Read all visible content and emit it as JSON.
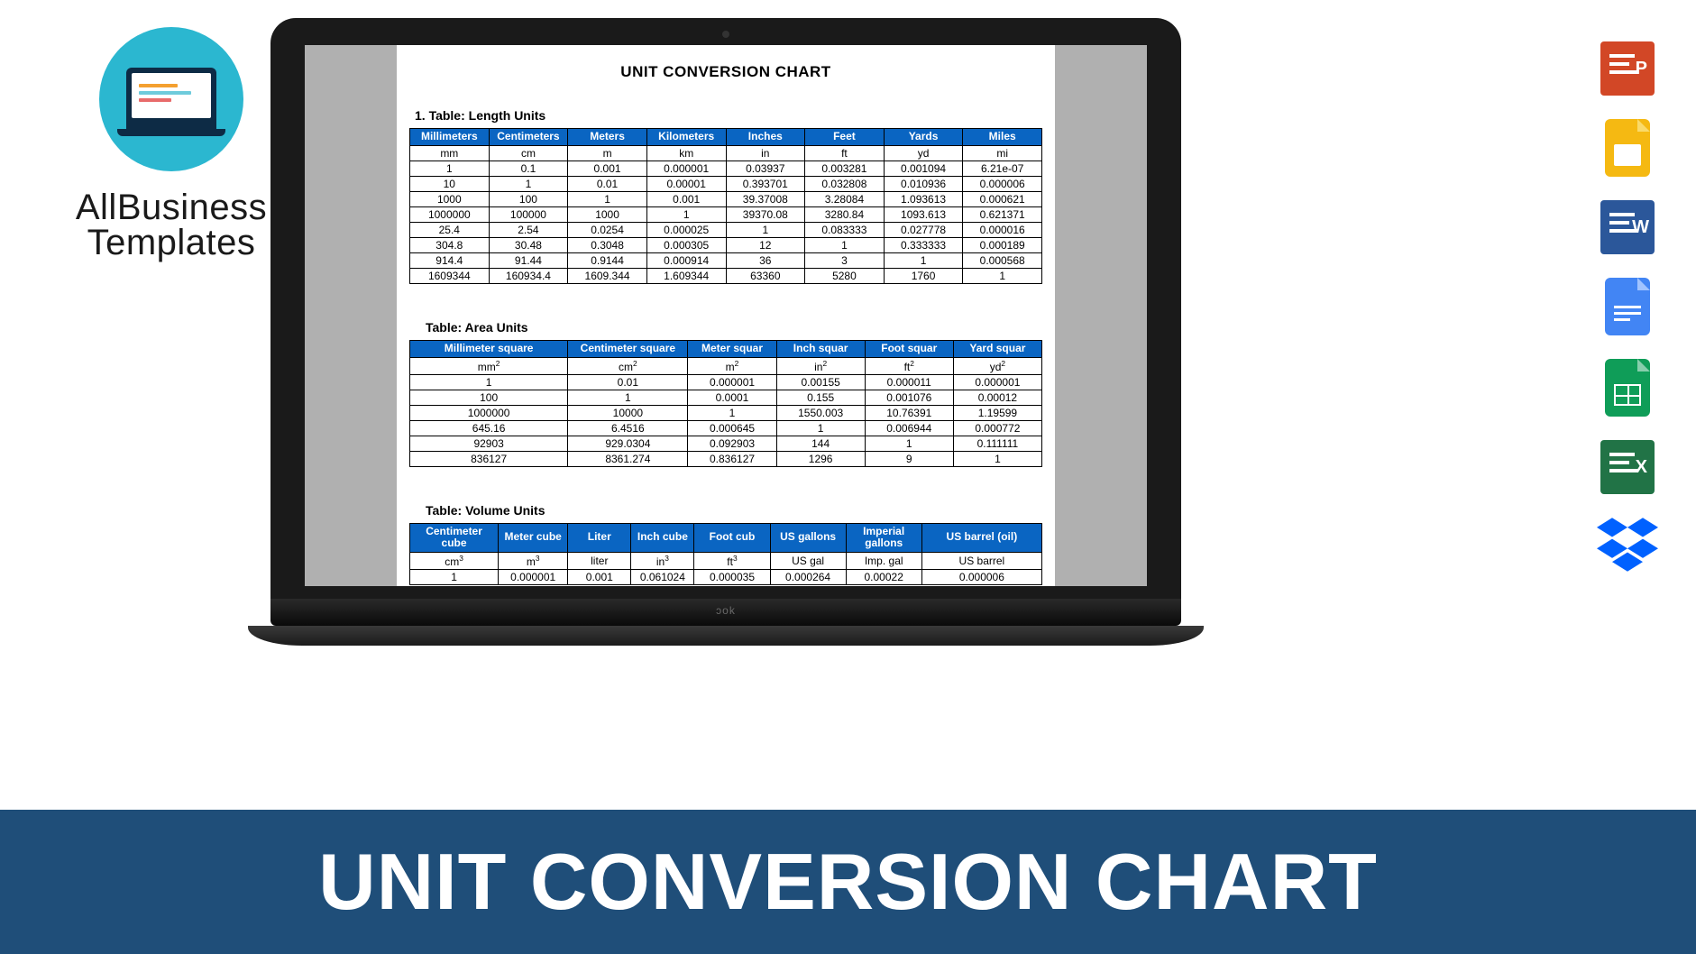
{
  "brand": {
    "line1": "AllBusiness",
    "line2": "Templates"
  },
  "banner_title": "UNIT CONVERSION CHART",
  "doc": {
    "title": "UNIT CONVERSION CHART",
    "section1_label": "1.   Table:  Length Units",
    "section2_label": "Table:  Area Units",
    "section3_label": "Table:  Volume Units"
  },
  "sidebar_icons": [
    "powerpoint",
    "google-slides",
    "word",
    "google-docs",
    "google-sheets",
    "excel",
    "dropbox"
  ],
  "chart_data": [
    {
      "type": "table",
      "title": "Length Units",
      "headers": [
        "Millimeters",
        "Centimeters",
        "Meters",
        "Kilometers",
        "Inches",
        "Feet",
        "Yards",
        "Miles"
      ],
      "unit_row": [
        "mm",
        "cm",
        "m",
        "km",
        "in",
        "ft",
        "yd",
        "mi"
      ],
      "rows": [
        [
          "1",
          "0.1",
          "0.001",
          "0.000001",
          "0.03937",
          "0.003281",
          "0.001094",
          "6.21e-07"
        ],
        [
          "10",
          "1",
          "0.01",
          "0.00001",
          "0.393701",
          "0.032808",
          "0.010936",
          "0.000006"
        ],
        [
          "1000",
          "100",
          "1",
          "0.001",
          "39.37008",
          "3.28084",
          "1.093613",
          "0.000621"
        ],
        [
          "1000000",
          "100000",
          "1000",
          "1",
          "39370.08",
          "3280.84",
          "1093.613",
          "0.621371"
        ],
        [
          "25.4",
          "2.54",
          "0.0254",
          "0.000025",
          "1",
          "0.083333",
          "0.027778",
          "0.000016"
        ],
        [
          "304.8",
          "30.48",
          "0.3048",
          "0.000305",
          "12",
          "1",
          "0.333333",
          "0.000189"
        ],
        [
          "914.4",
          "91.44",
          "0.9144",
          "0.000914",
          "36",
          "3",
          "1",
          "0.000568"
        ],
        [
          "1609344",
          "160934.4",
          "1609.344",
          "1.609344",
          "63360",
          "5280",
          "1760",
          "1"
        ]
      ]
    },
    {
      "type": "table",
      "title": "Area Units",
      "headers": [
        "Millimeter square",
        "Centimeter square",
        "Meter squar",
        "Inch squar",
        "Foot squar",
        "Yard squar"
      ],
      "unit_row": [
        "mm²",
        "cm²",
        "m²",
        "in²",
        "ft²",
        "yd²"
      ],
      "rows": [
        [
          "1",
          "0.01",
          "0.000001",
          "0.00155",
          "0.000011",
          "0.000001"
        ],
        [
          "100",
          "1",
          "0.0001",
          "0.155",
          "0.001076",
          "0.00012"
        ],
        [
          "1000000",
          "10000",
          "1",
          "1550.003",
          "10.76391",
          "1.19599"
        ],
        [
          "645.16",
          "6.4516",
          "0.000645",
          "1",
          "0.006944",
          "0.000772"
        ],
        [
          "92903",
          "929.0304",
          "0.092903",
          "144",
          "1",
          "0.111111"
        ],
        [
          "836127",
          "8361.274",
          "0.836127",
          "1296",
          "9",
          "1"
        ]
      ],
      "col_widths": [
        "25%",
        "19%",
        "14%",
        "14%",
        "14%",
        "14%"
      ]
    },
    {
      "type": "table",
      "title": "Volume Units",
      "headers": [
        "Centimeter cube",
        "Meter cube",
        "Liter",
        "Inch cube",
        "Foot cub",
        "US gallons",
        "Imperial gallons",
        "US barrel (oil)"
      ],
      "unit_row": [
        "cm³",
        "m³",
        "liter",
        "in³",
        "ft³",
        "US gal",
        "Imp. gal",
        "US barrel"
      ],
      "rows": [
        [
          "1",
          "0.000001",
          "0.001",
          "0.061024",
          "0.000035",
          "0.000264",
          "0.00022",
          "0.000006"
        ]
      ],
      "col_widths": [
        "14%",
        "11%",
        "10%",
        "10%",
        "12%",
        "12%",
        "12%",
        "19%"
      ]
    }
  ]
}
